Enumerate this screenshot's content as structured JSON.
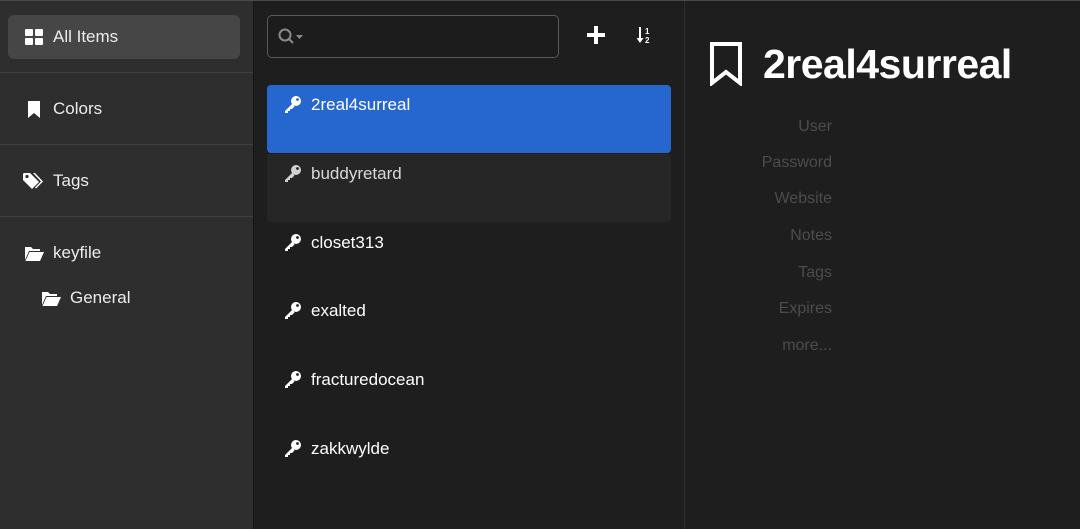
{
  "sidebar": {
    "items": [
      {
        "label": "All Items",
        "icon": "grid-icon"
      },
      {
        "label": "Colors",
        "icon": "bookmark-icon"
      },
      {
        "label": "Tags",
        "icon": "tags-icon"
      },
      {
        "label": "keyfile",
        "icon": "folder-open-icon"
      },
      {
        "label": "General",
        "icon": "folder-open-icon"
      }
    ]
  },
  "list": {
    "search": {
      "value": "",
      "placeholder": ""
    },
    "entries": [
      {
        "title": "2real4surreal",
        "icon": "key-icon"
      },
      {
        "title": "buddyretard",
        "icon": "key-icon"
      },
      {
        "title": "closet313",
        "icon": "key-icon"
      },
      {
        "title": "exalted",
        "icon": "key-icon"
      },
      {
        "title": "fracturedocean",
        "icon": "key-icon"
      },
      {
        "title": "zakkwylde",
        "icon": "key-icon"
      }
    ]
  },
  "detail": {
    "title": "2real4surreal",
    "icon": "bookmark-outline-icon",
    "fields": {
      "user": "User",
      "password": "Password",
      "website": "Website",
      "notes": "Notes",
      "tags": "Tags",
      "expires": "Expires",
      "more": "more..."
    }
  },
  "colors": {
    "accent": "#2667cf",
    "sidebar_bg": "#2e2e2e",
    "selected_nav": "#464646",
    "pane_bg": "#1e1e1e",
    "muted_label": "#4c4c4c"
  }
}
